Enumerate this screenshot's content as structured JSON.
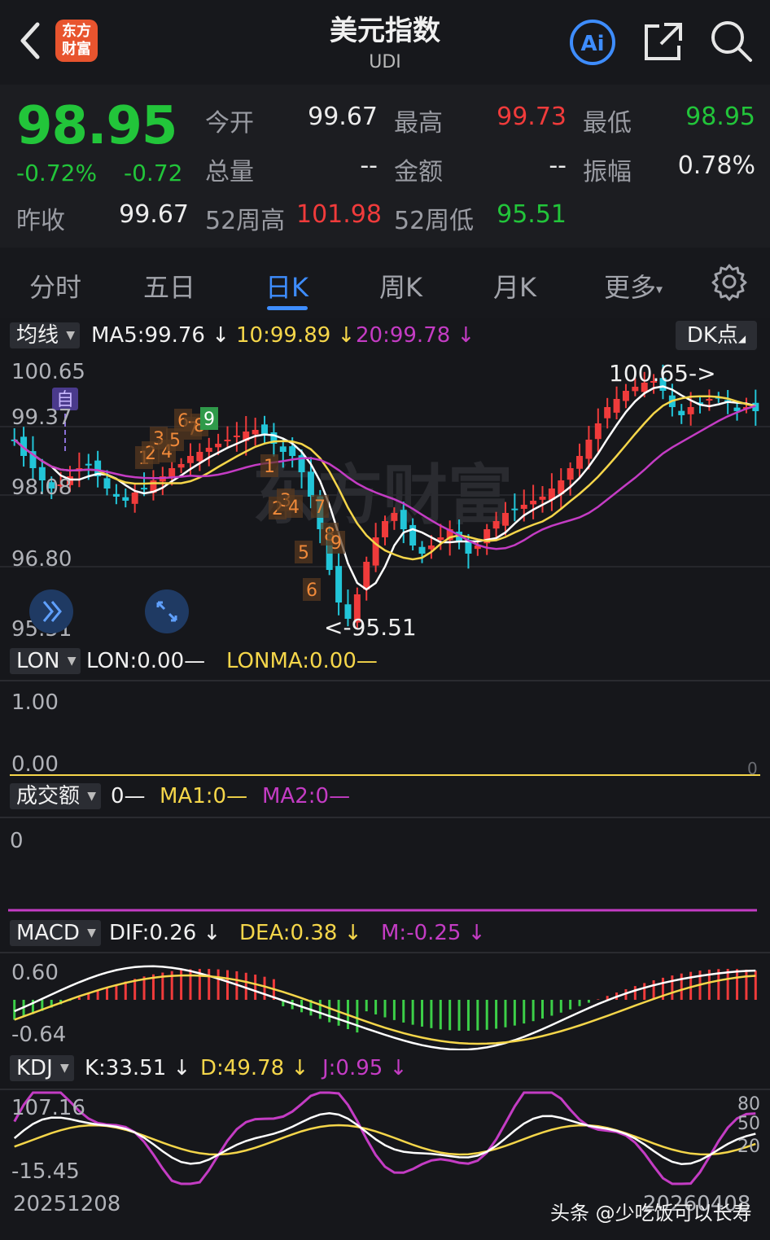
{
  "header": {
    "title": "美元指数",
    "subtitle": "UDI",
    "logo_line1": "东方",
    "logo_line2": "财富",
    "ai_label": "Ai"
  },
  "quote": {
    "price": "98.95",
    "change_pct": "-0.72%",
    "change": "-0.72",
    "prev_close_label": "昨收",
    "prev_close": "99.67",
    "open_label": "今开",
    "open": "99.67",
    "high_label": "最高",
    "high": "99.73",
    "low_label": "最低",
    "low": "98.95",
    "volume_label": "总量",
    "volume": "--",
    "amount_label": "金额",
    "amount": "--",
    "amplitude_label": "振幅",
    "amplitude": "0.78%",
    "wk52_high_label": "52周高",
    "wk52_high": "101.98",
    "wk52_low_label": "52周低",
    "wk52_low": "95.51"
  },
  "tabs": [
    {
      "label": "分时"
    },
    {
      "label": "五日"
    },
    {
      "label": "日K",
      "active": true
    },
    {
      "label": "周K"
    },
    {
      "label": "月K"
    },
    {
      "label": "更多"
    }
  ],
  "main_chart": {
    "ma_selector": "均线",
    "ma5": "MA5:99.76",
    "ma10": "10:99.89",
    "ma20": "20:99.78",
    "dk_button": "DK点",
    "self_marker": "自",
    "watermark": "东方财富",
    "high_marker": "100.65->",
    "low_marker": "<-95.51",
    "y_ticks": [
      "100.65",
      "99.37",
      "98.08",
      "96.80",
      "95.51"
    ]
  },
  "lon_panel": {
    "selector": "LON",
    "lon": "LON:0.00—",
    "lonma": "LONMA:0.00—",
    "y_ticks": [
      "1.00",
      "0.00"
    ],
    "right_value": "0"
  },
  "amount_panel": {
    "selector": "成交额",
    "value": "0—",
    "ma1": "MA1:0—",
    "ma2": "MA2:0—",
    "y_tick": "0"
  },
  "macd_panel": {
    "selector": "MACD",
    "dif": "DIF:0.26",
    "dea": "DEA:0.38",
    "m": "M:-0.25",
    "y_ticks": [
      "0.60",
      "-0.64"
    ]
  },
  "kdj_panel": {
    "selector": "KDJ",
    "k": "K:33.51",
    "d": "D:49.78",
    "j": "J:0.95",
    "y_ticks": [
      "107.16",
      "-15.45"
    ],
    "right_ticks": [
      "80",
      "50",
      "20"
    ]
  },
  "footer": {
    "start_date": "20251208",
    "end_date": "20260408",
    "watermark": "头条 @少吃饭可以长寿"
  },
  "colors": {
    "up": "#f03b3b",
    "down": "#22c5d8",
    "ma5": "#ffffff",
    "ma10": "#f5d64a",
    "ma20": "#c43cc4",
    "accent": "#3e8dff"
  }
}
